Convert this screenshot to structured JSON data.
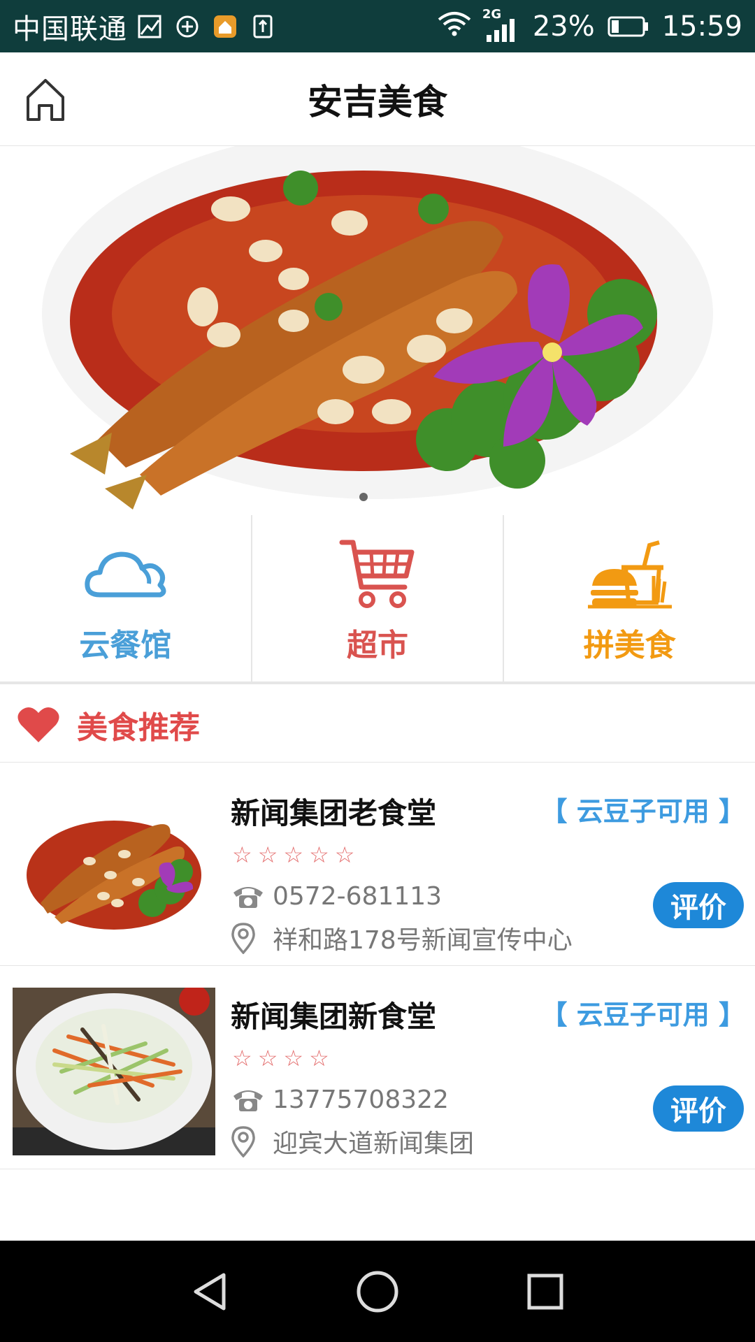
{
  "status_bar": {
    "carrier": "中国联通",
    "network": "2G",
    "battery": "23%",
    "time": "15:59"
  },
  "header": {
    "title": "安吉美食"
  },
  "categories": [
    {
      "label": "云餐馆",
      "color": "#4a9fd8",
      "icon": "cloud-icon"
    },
    {
      "label": "超市",
      "color": "#d9534f",
      "icon": "cart-icon"
    },
    {
      "label": "拼美食",
      "color": "#f29a12",
      "icon": "fastfood-icon"
    }
  ],
  "section": {
    "title": "美食推荐",
    "icon": "heart-icon"
  },
  "restaurants": [
    {
      "name": "新闻集团老食堂",
      "tag": "【 云豆子可用 】",
      "stars": "☆☆☆☆☆",
      "phone": "0572-681113",
      "address": "祥和路178号新闻宣传中心",
      "button": "评价"
    },
    {
      "name": "新闻集团新食堂",
      "tag": "【 云豆子可用 】",
      "stars": "☆☆☆☆",
      "phone": "13775708322",
      "address": "迎宾大道新闻集团",
      "button": "评价"
    }
  ]
}
